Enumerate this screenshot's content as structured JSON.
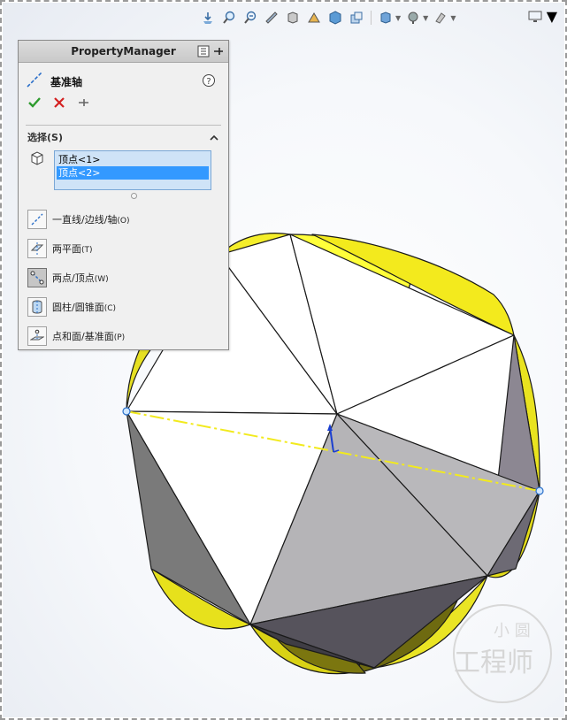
{
  "hud": {
    "icons": [
      "zoom-to-fit-icon",
      "zoom-area-icon",
      "previous-view-icon",
      "section-view-icon",
      "view-orientation-icon",
      "display-style-icon",
      "hide-show-icon",
      "edit-appearance-icon",
      "apply-scene-icon",
      "view-settings-icon",
      "monitor-icon"
    ]
  },
  "property_manager": {
    "header_title": "PropertyManager",
    "feature_title": "基准轴",
    "feature_icon": "axis-icon",
    "selections_label": "选择(S)",
    "selections": [
      {
        "label": "顶点<1>",
        "selected": false
      },
      {
        "label": "顶点<2>",
        "selected": true
      }
    ],
    "options": [
      {
        "label": "一直线/边线/轴",
        "hotkey": "(O)",
        "icon": "line-edge-axis-icon",
        "pressed": false
      },
      {
        "label": "两平面",
        "hotkey": "(T)",
        "icon": "two-planes-icon",
        "pressed": false
      },
      {
        "label": "两点/顶点",
        "hotkey": "(W)",
        "icon": "two-points-icon",
        "pressed": true
      },
      {
        "label": "圆柱/圆锥面",
        "hotkey": "(C)",
        "icon": "cylinder-cone-icon",
        "pressed": false
      },
      {
        "label": "点和面/基准面",
        "hotkey": "(P)",
        "icon": "point-plane-icon",
        "pressed": false
      }
    ]
  },
  "colors": {
    "accent_selected": "#3399ff",
    "ok_green": "#2e9b2e",
    "cancel_red": "#d42020",
    "preview_axis": "#f2ea1e",
    "shell_yellow": "#ffff33"
  },
  "watermark": {
    "top": "小 圆",
    "bottom": "工程师"
  }
}
